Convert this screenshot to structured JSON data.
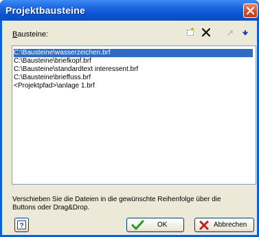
{
  "window": {
    "title": "Projektbausteine"
  },
  "bausteine_label": {
    "text": "Bausteine:"
  },
  "files": [
    "C:\\Bausteine\\wasserzeichen.brf",
    "C:\\Bausteine\\briefkopf.brf",
    "C:\\Bausteine\\standardtext interessent.brf",
    "C:\\Bausteine\\brieffuss.brf",
    "<Projektpfad>\\anlage 1.brf"
  ],
  "hint": "Verschieben Sie die Dateien in die gewünschte Reihenfolge über die Buttons oder Drag&Drop.",
  "buttons": {
    "ok": "OK",
    "cancel": "Abbrechen"
  },
  "colors": {
    "title_bar": "#0a53d2",
    "selection": "#316ac5",
    "dialog_bg": "#ece9d8",
    "close_button": "#d6491f"
  }
}
